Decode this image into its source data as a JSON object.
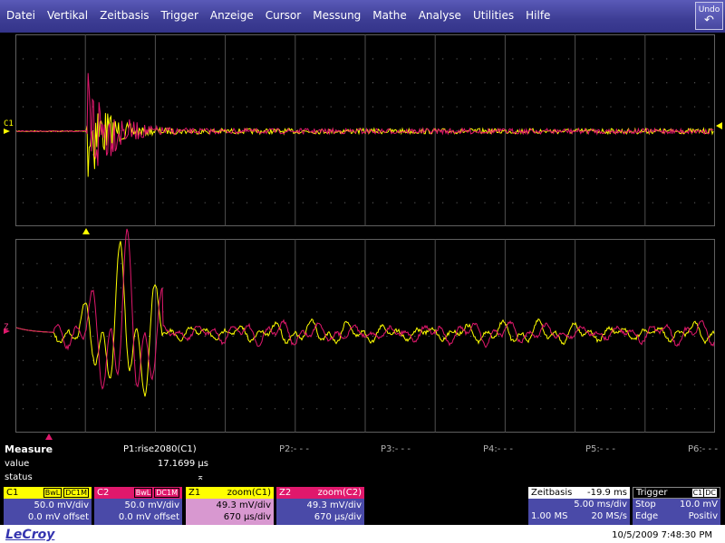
{
  "menu": [
    "Datei",
    "Vertikal",
    "Zeitbasis",
    "Trigger",
    "Anzeige",
    "Cursor",
    "Messung",
    "Mathe",
    "Analyse",
    "Utilities",
    "Hilfe"
  ],
  "undo": {
    "label": "Undo",
    "icon": "undo-arrow-icon"
  },
  "channels": {
    "c1_label": "C1",
    "z_label": "Z"
  },
  "colors": {
    "c1": "#ffff00",
    "c2": "#e0186c",
    "grid": "#606060",
    "menu": "#3d3d94"
  },
  "measure": {
    "title": "Measure",
    "row_value": "value",
    "row_status": "status",
    "p1": "P1:rise2080(C1)",
    "p1_value": "17.1699 µs",
    "p1_status": "⌅",
    "p2": "P2:- - -",
    "p3": "P3:- - -",
    "p4": "P4:- - -",
    "p5": "P5:- - -",
    "p6": "P6:- - -"
  },
  "boxes": {
    "c1": {
      "name": "C1",
      "tag1": "BwL",
      "tag2": "DC1M",
      "line1": "50.0 mV/div",
      "line2": "0.0 mV offset"
    },
    "c2": {
      "name": "C2",
      "tag1": "BwL",
      "tag2": "DC1M",
      "line1": "50.0 mV/div",
      "line2": "0.0 mV offset"
    },
    "z1": {
      "name": "Z1",
      "src": "zoom(C1)",
      "line1": "49.3 mV/div",
      "line2": "670 µs/div"
    },
    "z2": {
      "name": "Z2",
      "src": "zoom(C2)",
      "line1": "49.3 mV/div",
      "line2": "670 µs/div"
    }
  },
  "timebase": {
    "title": "Zeitbasis",
    "delay": "-19.9 ms",
    "tdiv": "5.00 ms/div",
    "points": "1.00 MS",
    "rate": "20 MS/s"
  },
  "trigger": {
    "title": "Trigger",
    "src": "C1",
    "coupling": "DC",
    "mode": "Stop",
    "level": "10.0 mV",
    "type": "Edge",
    "slope": "Positiv"
  },
  "footer": {
    "brand": "LeCroy",
    "datetime": "10/5/2009 7:48:30 PM"
  }
}
